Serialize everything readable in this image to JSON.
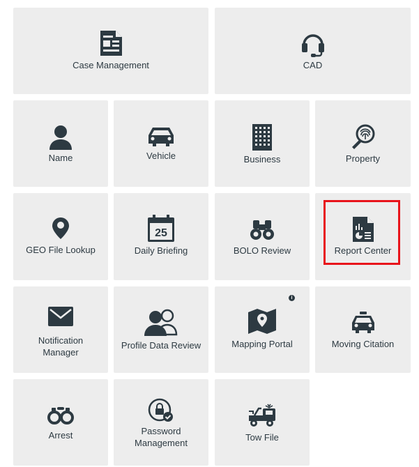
{
  "tiles": {
    "case_management": "Case Management",
    "cad": "CAD",
    "name": "Name",
    "vehicle": "Vehicle",
    "business": "Business",
    "property": "Property",
    "geo_file_lookup": "GEO File Lookup",
    "daily_briefing": "Daily Briefing",
    "daily_briefing_day": "25",
    "bolo_review": "BOLO Review",
    "report_center": "Report Center",
    "notification_manager_1": "Notification",
    "notification_manager_2": "Manager",
    "profile_data_review": "Profile Data Review",
    "mapping_portal": "Mapping Portal",
    "mapping_portal_info": "i",
    "moving_citation": "Moving Citation",
    "arrest": "Arrest",
    "password_management_1": "Password",
    "password_management_2": "Management",
    "tow_file": "Tow File"
  },
  "colors": {
    "tile_bg": "#ededed",
    "icon": "#2d3a42",
    "highlight": "#e8141b"
  }
}
